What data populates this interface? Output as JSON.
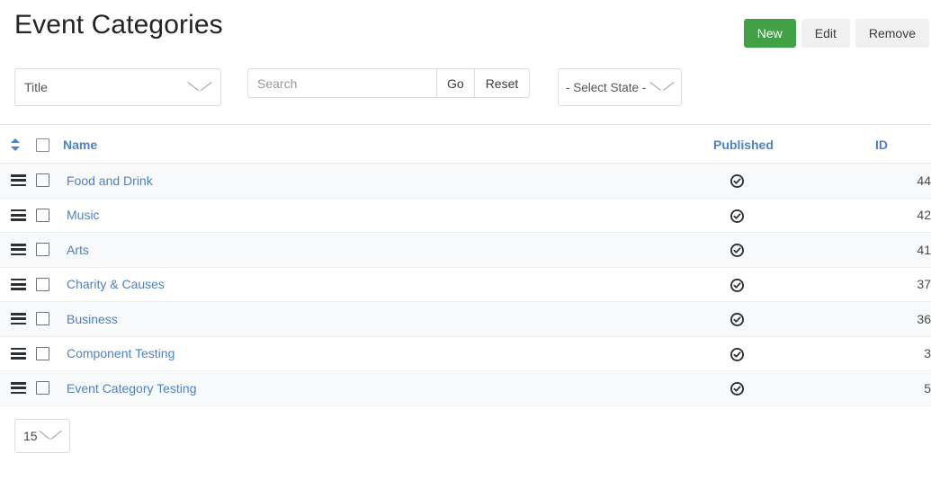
{
  "header": {
    "title": "Event Categories",
    "buttons": [
      {
        "label": "New",
        "name": "new-button",
        "style": "primary"
      },
      {
        "label": "Edit",
        "name": "edit-button",
        "style": "default"
      },
      {
        "label": "Remove",
        "name": "remove-button",
        "style": "default"
      }
    ]
  },
  "filters": {
    "sort_select": {
      "value": "Title"
    },
    "search": {
      "value": "",
      "placeholder": "Search"
    },
    "go_label": "Go",
    "reset_label": "Reset",
    "state_select": {
      "value": "- Select State -"
    }
  },
  "table": {
    "columns": {
      "order": "",
      "checkbox": "",
      "name": "Name",
      "published": "Published",
      "id": "ID"
    },
    "rows": [
      {
        "name": "Food and Drink",
        "published": "published",
        "id": "44"
      },
      {
        "name": "Music",
        "published": "published",
        "id": "42"
      },
      {
        "name": "Arts",
        "published": "published",
        "id": "41"
      },
      {
        "name": "Charity & Causes",
        "published": "published",
        "id": "37"
      },
      {
        "name": "Business",
        "published": "published",
        "id": "36"
      },
      {
        "name": "Component Testing",
        "published": "published",
        "id": "3"
      },
      {
        "name": "Event Category Testing",
        "published": "published",
        "id": "5"
      }
    ]
  },
  "footer": {
    "limit": {
      "value": "15"
    }
  },
  "colors": {
    "accent_link": "#4b83c4",
    "primary_button": "#42a047",
    "row_stripe": "#f8f9fa",
    "border": "#dcdcdc"
  }
}
